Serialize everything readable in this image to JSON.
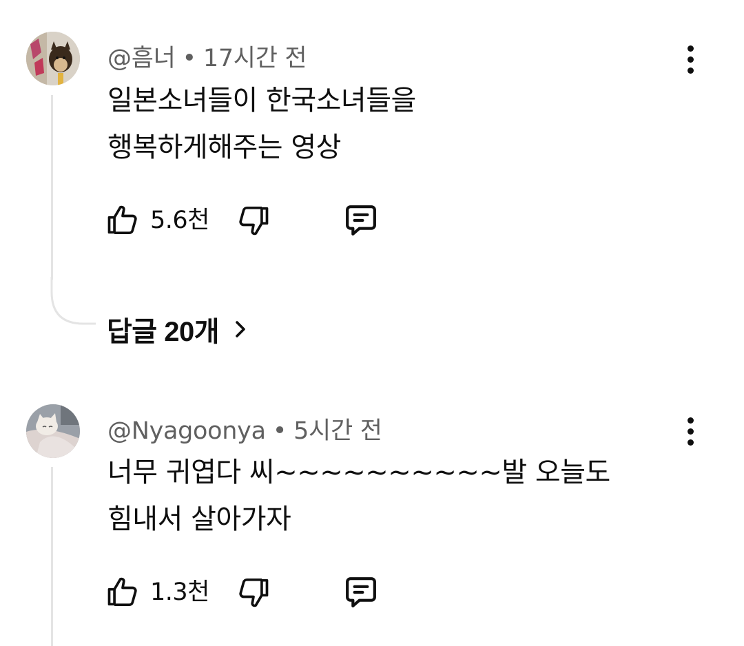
{
  "comments": [
    {
      "author": "@흠너",
      "separator": "•",
      "time": "17시간 전",
      "text_lines": [
        "일본소녀들이 한국소녀들을",
        "행복하게해주는 영상"
      ],
      "likes": "5.6천",
      "replies_label": "답글 20개",
      "icons": {
        "more": "more-vert-icon",
        "like": "thumb-up-icon",
        "dislike": "thumb-down-icon",
        "reply": "reply-comment-icon",
        "replies": "chevron-right-icon"
      }
    },
    {
      "author": "@Nyagoonya",
      "separator": "•",
      "time": "5시간 전",
      "text_lines": [
        "너무 귀엽다 씨~~~~~~~~~~발 오늘도",
        "힘내서 살아가자"
      ],
      "likes": "1.3천",
      "icons": {
        "more": "more-vert-icon",
        "like": "thumb-up-icon",
        "dislike": "thumb-down-icon",
        "reply": "reply-comment-icon"
      }
    }
  ],
  "colors": {
    "text": "#0f0f0f",
    "meta": "#606060",
    "thread_line": "#e4e4e4",
    "background": "#ffffff"
  }
}
